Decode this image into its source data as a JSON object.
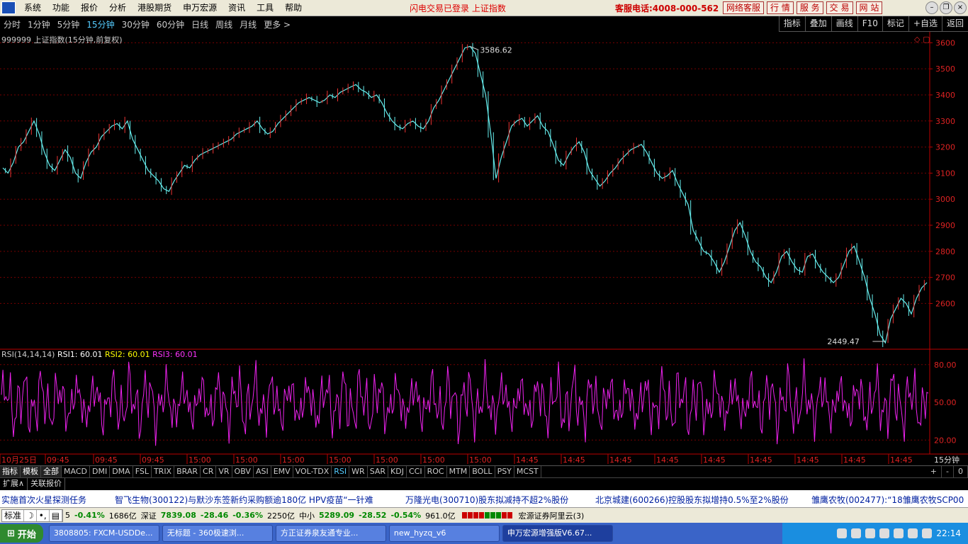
{
  "menubar": {
    "items": [
      "系统",
      "功能",
      "报价",
      "分析",
      "港股期货",
      "申万宏源",
      "资讯",
      "工具",
      "帮助"
    ],
    "login_status": "闪电交易已登录   上证指数",
    "hotline": "客服电话:4008-000-562",
    "buttons": [
      "网络客服",
      "行 情",
      "服 务",
      "交 易",
      "网 站"
    ]
  },
  "periods": {
    "items": [
      "分时",
      "1分钟",
      "5分钟",
      "15分钟",
      "30分钟",
      "60分钟",
      "日线",
      "周线",
      "月线",
      "更多 >"
    ],
    "active": "15分钟"
  },
  "right_tools": [
    "指标",
    "叠加",
    "画线",
    "F10",
    "标记",
    "+自选",
    "返回"
  ],
  "chart": {
    "title": "999999 上证指数(15分钟,前复权)",
    "high_label": "3586.62",
    "low_label": "2449.47",
    "period_label": "15分钟",
    "rsi_legend": {
      "name": "RSI(14,14,14)",
      "rsi1": "RSI1: 60.01",
      "rsi2": "RSI2: 60.01",
      "rsi3": "RSI3: 60.01"
    },
    "time_labels": [
      "10月25日",
      "09:45",
      "09:45",
      "09:45",
      "15:00",
      "15:00",
      "15:00",
      "15:00",
      "15:00",
      "15:00",
      "15:00",
      "14:45",
      "14:45",
      "14:45",
      "14:45",
      "14:45",
      "14:45",
      "14:45",
      "14:45",
      "14:45"
    ]
  },
  "chart_data": {
    "type": "line",
    "price_axis": {
      "ticks": [
        3600,
        3500,
        3400,
        3300,
        3200,
        3100,
        3000,
        2900,
        2800,
        2700,
        2600
      ],
      "ylim": [
        2430,
        3620
      ]
    },
    "rsi_axis": {
      "ticks": [
        80,
        50,
        20
      ],
      "ylim": [
        10,
        90
      ]
    },
    "price_series": [
      3120,
      3100,
      3140,
      3200,
      3220,
      3260,
      3300,
      3250,
      3180,
      3130,
      3110,
      3150,
      3190,
      3160,
      3100,
      3080,
      3140,
      3180,
      3200,
      3240,
      3260,
      3280,
      3290,
      3270,
      3300,
      3230,
      3190,
      3150,
      3110,
      3090,
      3070,
      3040,
      3030,
      3070,
      3100,
      3130,
      3120,
      3150,
      3170,
      3180,
      3190,
      3200,
      3210,
      3220,
      3230,
      3250,
      3260,
      3270,
      3280,
      3300,
      3270,
      3250,
      3260,
      3290,
      3310,
      3330,
      3350,
      3370,
      3380,
      3390,
      3380,
      3370,
      3380,
      3400,
      3390,
      3410,
      3420,
      3430,
      3440,
      3420,
      3410,
      3390,
      3400,
      3370,
      3330,
      3300,
      3280,
      3270,
      3290,
      3300,
      3280,
      3270,
      3300,
      3350,
      3380,
      3420,
      3460,
      3500,
      3540,
      3580,
      3586,
      3560,
      3480,
      3400,
      3250,
      3080,
      3160,
      3220,
      3280,
      3300,
      3310,
      3280,
      3300,
      3320,
      3280,
      3260,
      3210,
      3150,
      3130,
      3170,
      3200,
      3220,
      3180,
      3110,
      3080,
      3050,
      3070,
      3100,
      3120,
      3150,
      3170,
      3190,
      3200,
      3210,
      3180,
      3140,
      3100,
      3080,
      3090,
      3110,
      3060,
      3020,
      2980,
      2880,
      2840,
      2800,
      2790,
      2760,
      2720,
      2760,
      2820,
      2880,
      2910,
      2860,
      2800,
      2760,
      2740,
      2700,
      2680,
      2720,
      2780,
      2800,
      2760,
      2730,
      2720,
      2780,
      2790,
      2750,
      2720,
      2700,
      2680,
      2700,
      2750,
      2800,
      2820,
      2760,
      2700,
      2620,
      2560,
      2480,
      2449,
      2540,
      2580,
      2620,
      2600,
      2560,
      2620,
      2660,
      2680
    ]
  },
  "indicators": {
    "tabs": [
      "指标",
      "模板",
      "全部"
    ],
    "items": [
      "MACD",
      "DMI",
      "DMA",
      "FSL",
      "TRIX",
      "BRAR",
      "CR",
      "VR",
      "OBV",
      "ASI",
      "EMV",
      "VOL-TDX",
      "RSI",
      "WR",
      "SAR",
      "KDJ",
      "CCI",
      "ROC",
      "MTM",
      "BOLL",
      "PSY",
      "MCST"
    ],
    "active": "RSI",
    "zoom": [
      "+",
      "-",
      "0"
    ]
  },
  "expand": [
    "扩展∧",
    "关联报价"
  ],
  "ticker": [
    "实施首次火星探测任务",
    "智飞生物(300122)与默沙东签新约采购额逾180亿 HPV疫苗“一针难",
    "万隆光电(300710)股东拟减持不超2%股份",
    "北京城建(600266)控股股东拟增持0.5%至2%股份",
    "雏鹰农牧(002477):“18雏鹰农牧SCP00"
  ],
  "status": {
    "modes": [
      "标准",
      "☽",
      "•,",
      "▤"
    ],
    "sh_tail": "5",
    "sh_pct": "-0.41%",
    "sh_amount": "1686亿",
    "sz_label": "深证",
    "sz_value": "7839.08",
    "sz_change": "-28.46",
    "sz_pct": "-0.36%",
    "sz_amount": "2250亿",
    "zx_label": "中小",
    "zx_value": "5289.09",
    "zx_change": "-28.52",
    "zx_pct": "-0.54%",
    "zx_amount": "961.0亿",
    "server": "宏源证券阿里云(3)"
  },
  "taskbar": {
    "start": "开始",
    "tasks": [
      "3808805: FXCM-USDDe...",
      "无标题 - 360极速浏...",
      "方正证券泉友通专业...",
      "new_hyzq_v6",
      "申万宏源增强版V6.67..."
    ],
    "clock": "22:14"
  }
}
